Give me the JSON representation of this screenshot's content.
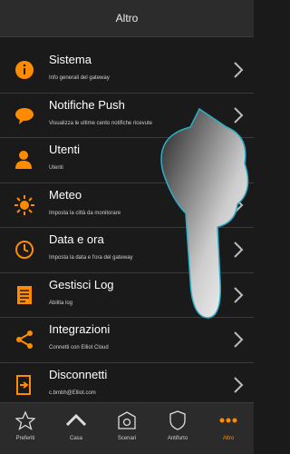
{
  "header": {
    "title": "Altro"
  },
  "items": [
    {
      "title": "Sistema",
      "subtitle": "Info generali del gateway",
      "icon": "info-circle-icon"
    },
    {
      "title": "Notifiche Push",
      "subtitle": "Visualizza le ultime cento notifiche ricevute",
      "icon": "chat-bubble-icon"
    },
    {
      "title": "Utenti",
      "subtitle": "Utenti",
      "icon": "user-icon"
    },
    {
      "title": "Meteo",
      "subtitle": "Imposta la città da monitorare",
      "icon": "sun-icon"
    },
    {
      "title": "Data e ora",
      "subtitle": "Imposta la data e l'ora del gateway",
      "icon": "clock-icon"
    },
    {
      "title": "Gestisci Log",
      "subtitle": "Abilita log",
      "icon": "document-icon"
    },
    {
      "title": "Integrazioni",
      "subtitle": "Connetti con Elliot Cloud",
      "icon": "share-icon"
    },
    {
      "title": "Disconnetti",
      "subtitle": "c.bmbh@Elliot.com",
      "icon": "logout-icon"
    }
  ],
  "tabs": [
    {
      "label": "Preferiti",
      "icon": "star-icon",
      "active": false
    },
    {
      "label": "Casa",
      "icon": "house-icon",
      "active": false
    },
    {
      "label": "Scenari",
      "icon": "scenario-icon",
      "active": false
    },
    {
      "label": "Antifurto",
      "icon": "shield-icon",
      "active": false
    },
    {
      "label": "Altro",
      "icon": "more-dots-icon",
      "active": true
    }
  ],
  "colors": {
    "accent": "#ff8c00",
    "background": "#1a1a1a",
    "header": "#2c2c2c"
  }
}
